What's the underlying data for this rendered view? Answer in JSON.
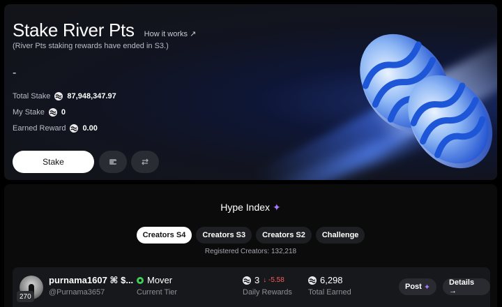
{
  "stake": {
    "title": "Stake River Pts",
    "how_link": "How it works ↗",
    "subtitle": "(River Pts staking rewards have ended in S3.)",
    "dash": "-",
    "total_label": "Total Stake",
    "total_value": "87,948,347.97",
    "my_label": "My Stake",
    "my_value": "0",
    "earned_label": "Earned Reward",
    "earned_value": "0.00",
    "stake_button": "Stake",
    "icon_button_1": "wallet-icon",
    "icon_button_2": "swap-icon"
  },
  "hype": {
    "title": "Hype Index",
    "title_icon": "sparkle-icon",
    "tabs": [
      {
        "label": "Creators S4",
        "active": true
      },
      {
        "label": "Creators S3",
        "active": false
      },
      {
        "label": "Creators S2",
        "active": false
      },
      {
        "label": "Challenge",
        "active": false
      }
    ],
    "registered": "Registered Creators: 132,218"
  },
  "row": {
    "rank": "270",
    "username": "purnama1607 ⌘ $...",
    "handle": "@Purnama3657",
    "tier": "Mover",
    "tier_label": "Current Tier",
    "daily_value": "3",
    "daily_delta": "↓ -5.58",
    "daily_label": "Daily Rewards",
    "total_value": "6,298",
    "total_label": "Total Earned",
    "post_button": "Post",
    "details_button": "Details →"
  },
  "colors": {
    "accent_purple": "#a77bff",
    "delta_red": "#ff5b5b",
    "tier_green": "#3fcf57"
  }
}
